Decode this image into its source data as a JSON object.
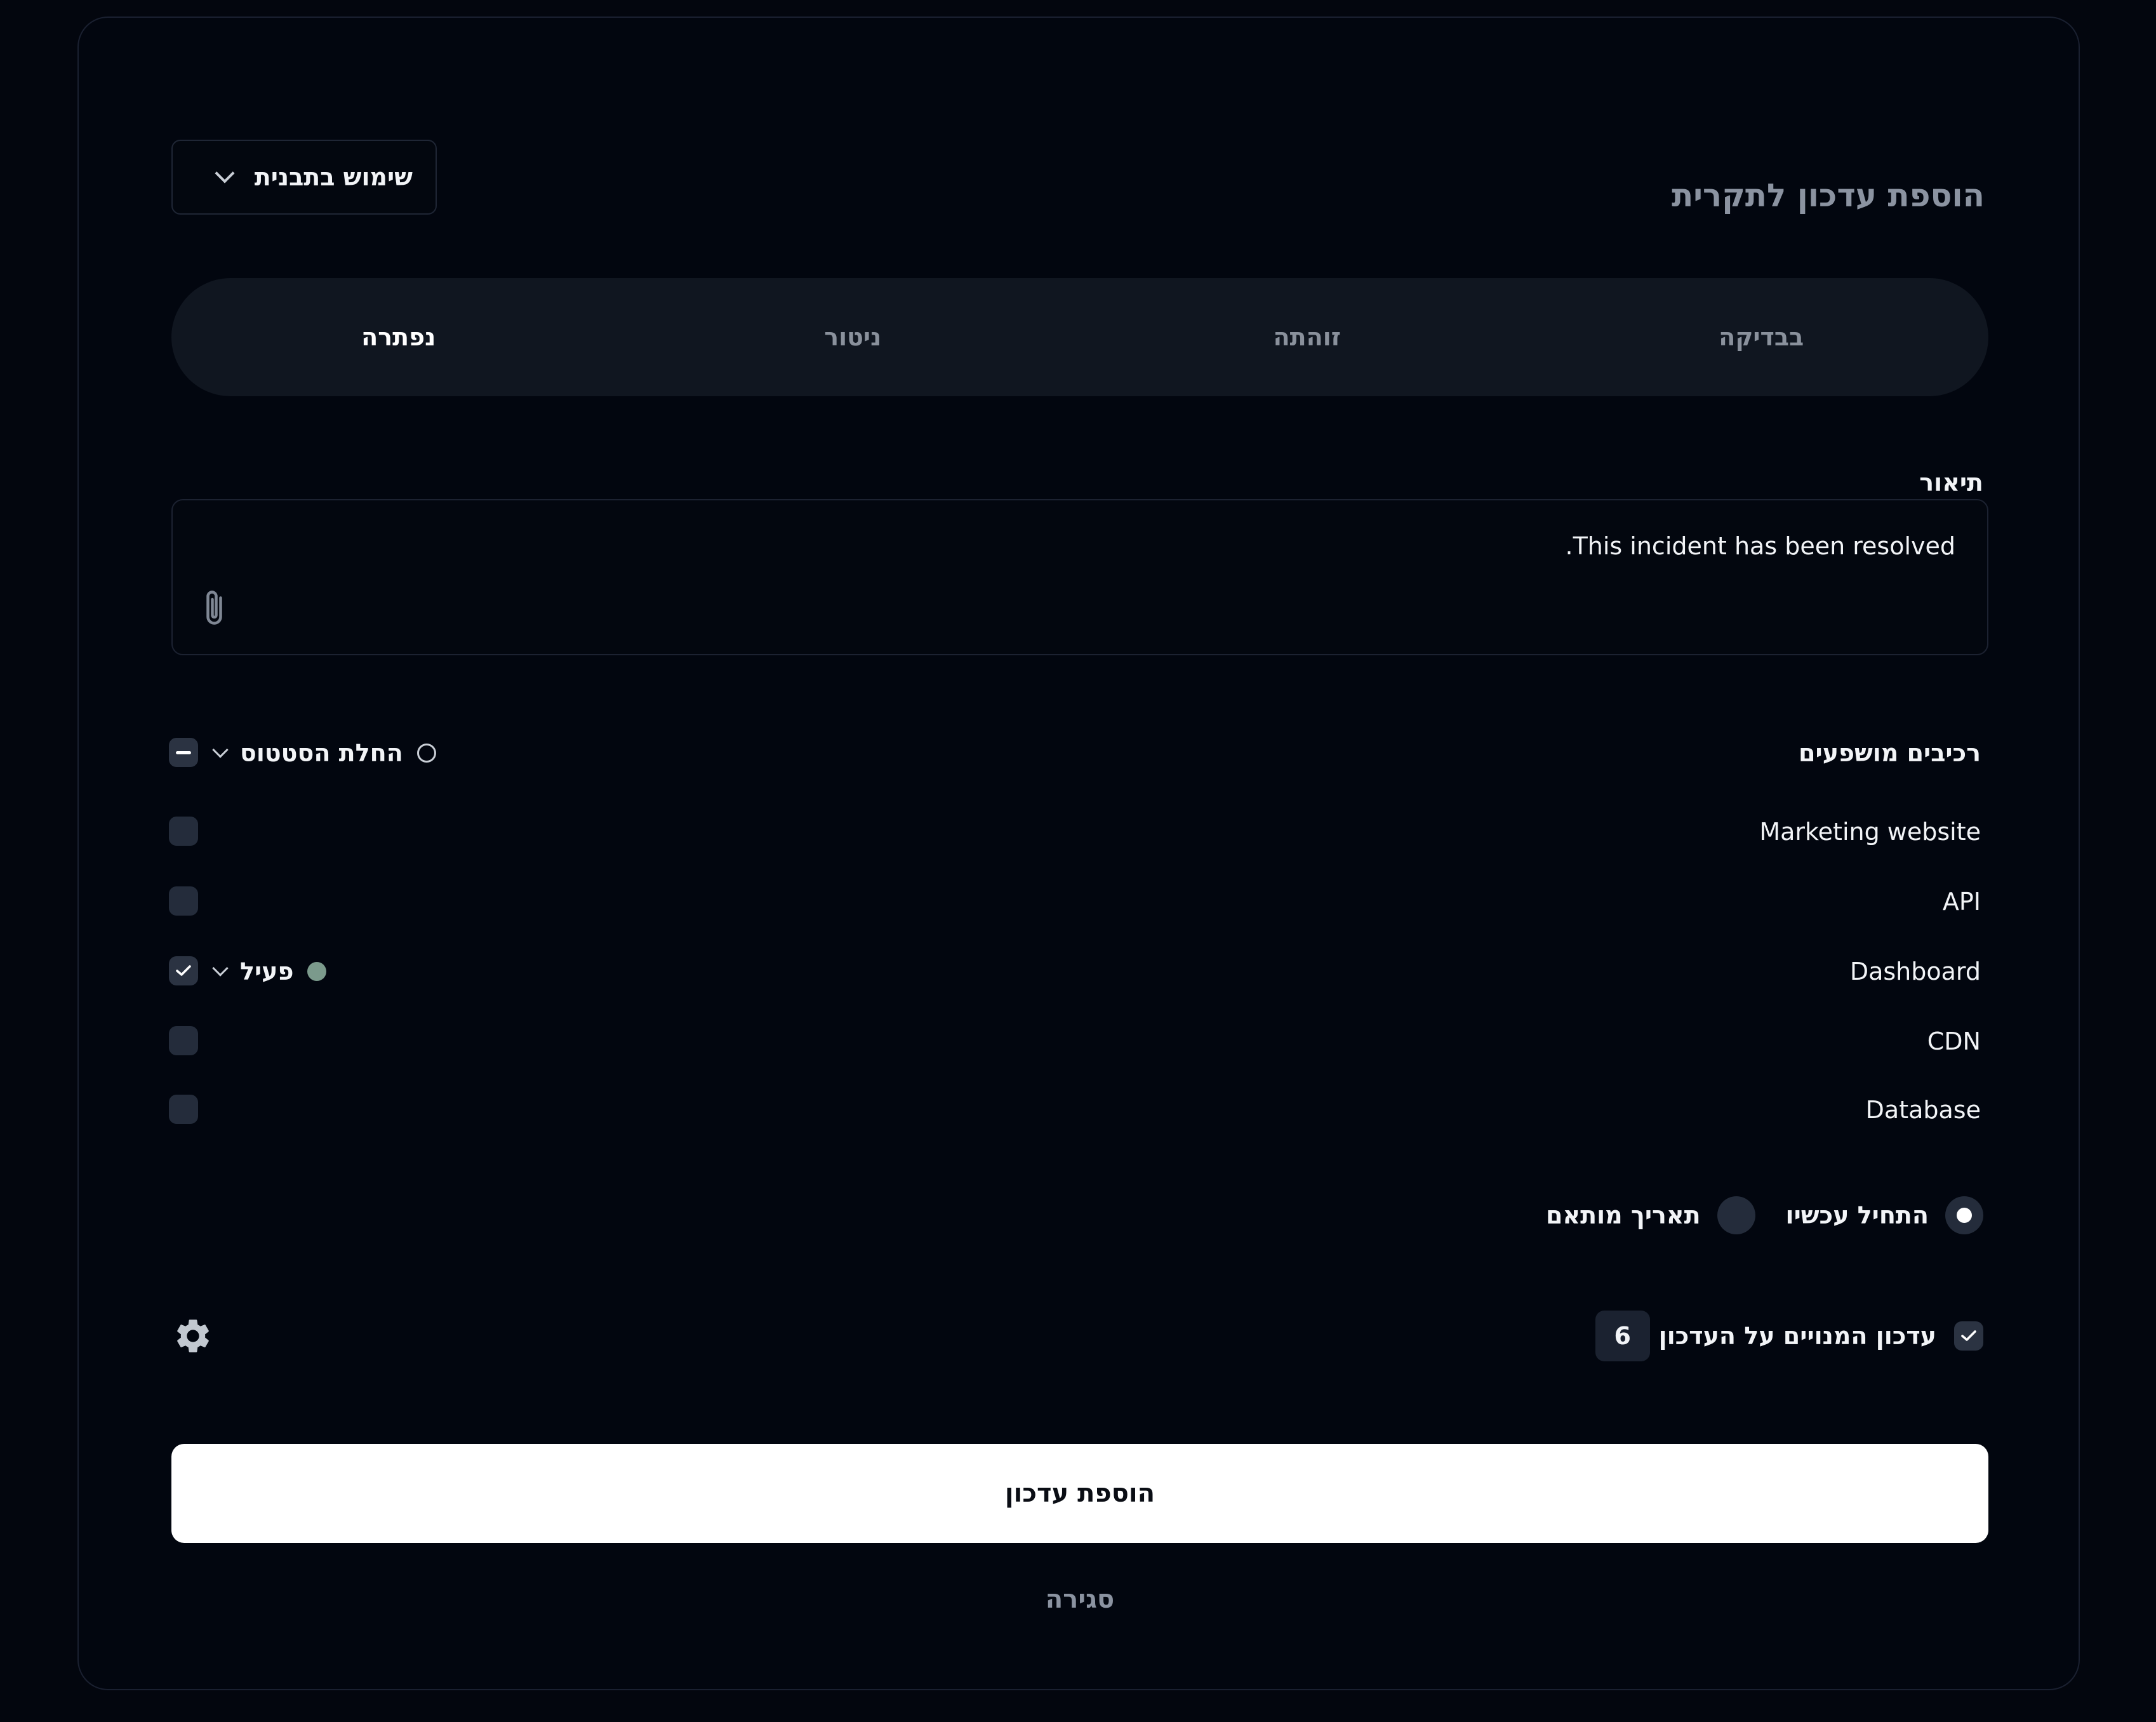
{
  "dialog": {
    "title": "הוספת עדכון לתקרית",
    "template_button_label": "שימוש בתבנית"
  },
  "tabs": [
    {
      "label": "בבדיקה",
      "active": false
    },
    {
      "label": "זוהתה",
      "active": false
    },
    {
      "label": "ניטור",
      "active": false
    },
    {
      "label": "נפתרה",
      "active": true
    }
  ],
  "description": {
    "label": "תיאור",
    "value": "This incident has been resolved."
  },
  "components": {
    "label": "רכיבים מושפעים",
    "bulk_status_label": "החלת הסטטוס",
    "items": [
      {
        "name": "Marketing website",
        "checked": false,
        "status": ""
      },
      {
        "name": "API",
        "checked": false,
        "status": ""
      },
      {
        "name": "Dashboard",
        "checked": true,
        "status": "פעיל"
      },
      {
        "name": "CDN",
        "checked": false,
        "status": ""
      },
      {
        "name": "Database",
        "checked": false,
        "status": ""
      }
    ]
  },
  "timing": {
    "options": [
      {
        "label": "התחיל עכשיו",
        "selected": true
      },
      {
        "label": "תאריך מותאם",
        "selected": false
      }
    ]
  },
  "notify": {
    "label": "עדכון המנויים על העדכון",
    "checked": true,
    "count": "6"
  },
  "actions": {
    "submit_label": "הוספת עדכון",
    "close_label": "סגירה"
  },
  "colors": {
    "background": "#02060f",
    "surface": "#101620",
    "control": "#242c3b",
    "primary_button": "#ffffff",
    "muted_text": "#8b93a1",
    "status_active": "#7b9a8c"
  }
}
